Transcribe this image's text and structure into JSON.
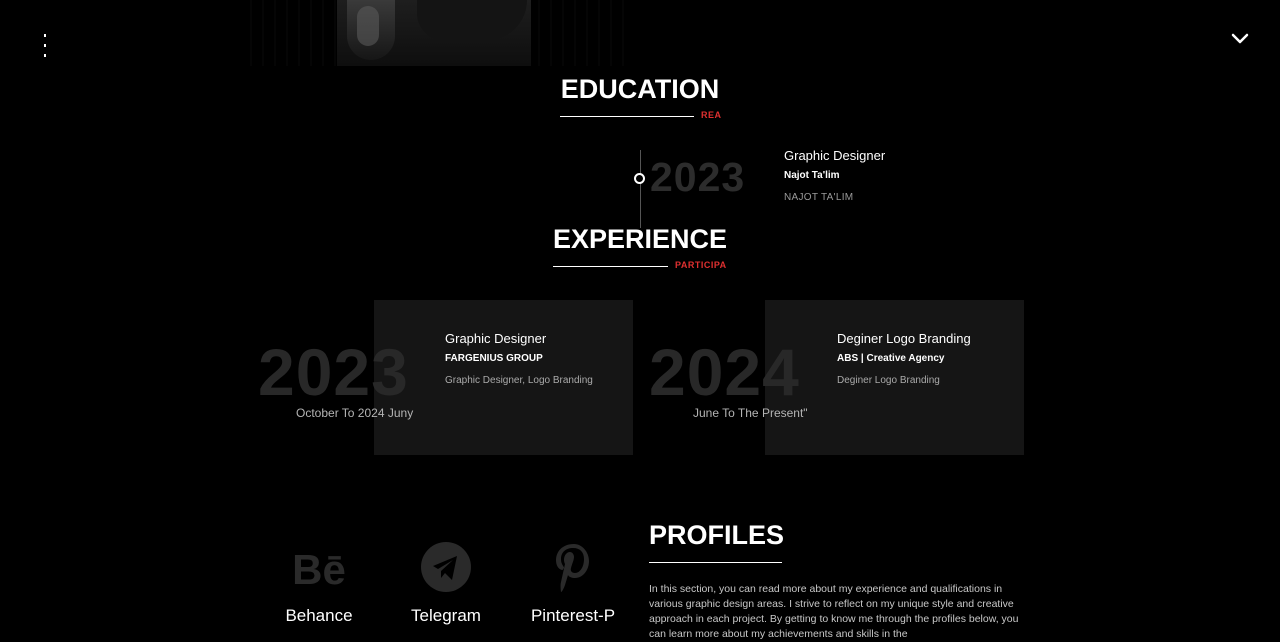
{
  "education": {
    "title": "EDUCATION",
    "tag": "REA",
    "items": [
      {
        "year": "2023",
        "role": "Graphic Designer",
        "org": "Najot Ta'lim",
        "desc": "NAJOT TA'LIM"
      }
    ]
  },
  "experience": {
    "title": "EXPERIENCE",
    "tag": "PARTICIPA",
    "items": [
      {
        "year": "2023",
        "period": "October To 2024 Juny",
        "role": "Graphic Designer",
        "org": "FARGENIUS GROUP",
        "desc": "Graphic Designer, Logo Branding"
      },
      {
        "year": "2024",
        "period": "June To The Present\"",
        "role": "Deginer Logo Branding",
        "org": "ABS | Creative Agency",
        "desc": "Deginer Logo Branding"
      }
    ]
  },
  "profiles": {
    "title": "PROFILES",
    "links": [
      {
        "label": "Behance",
        "icon": "behance-icon"
      },
      {
        "label": "Telegram",
        "icon": "telegram-icon"
      },
      {
        "label": "Pinterest-P",
        "icon": "pinterest-icon"
      }
    ],
    "description": "In this section, you can read more about my experience and qualifications in various graphic design areas. I strive to reflect on my unique style and creative approach in each project. By getting to know me through the profiles below, you can learn more about my achievements and skills in the"
  },
  "nav": {
    "toggle_icon": "chevron-down-icon"
  },
  "colors": {
    "background": "#000000",
    "accent": "#e03030",
    "card": "#151515"
  }
}
